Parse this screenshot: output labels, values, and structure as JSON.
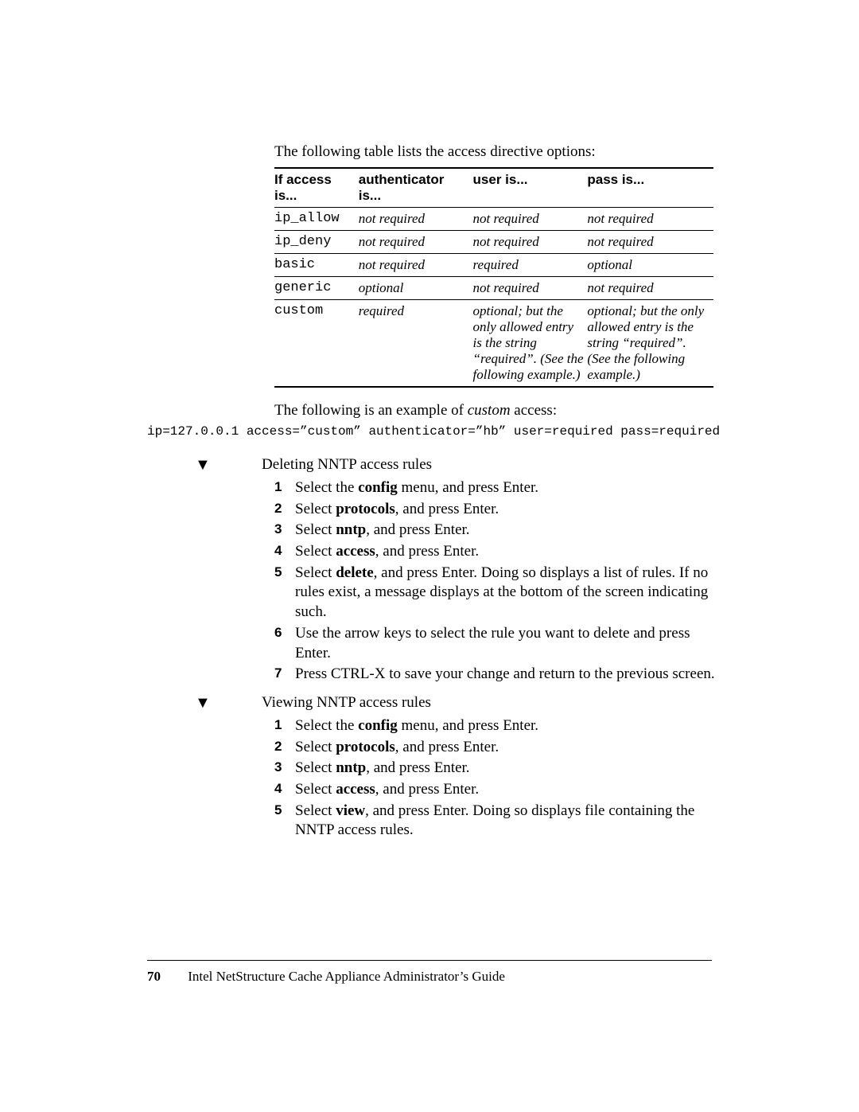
{
  "intro": "The following table lists the access directive options:",
  "table": {
    "headers": [
      "If access is...",
      "authenticator is...",
      "user is...",
      "pass is..."
    ],
    "rows": [
      {
        "access": "ip_allow",
        "auth": "not required",
        "user": "not required",
        "pass": "not required"
      },
      {
        "access": "ip_deny",
        "auth": "not required",
        "user": "not required",
        "pass": "not required"
      },
      {
        "access": "basic",
        "auth": "not required",
        "user": "required",
        "pass": "optional"
      },
      {
        "access": "generic",
        "auth": "optional",
        "user": "not required",
        "pass": "not required"
      },
      {
        "access": "custom",
        "auth": "required",
        "user": "optional; but the only allowed entry is the string “required”. (See the following example.)",
        "pass": "optional; but the only allowed entry is the string “required”. (See the following example.)"
      }
    ]
  },
  "example_intro_pre": "The following is an example of ",
  "example_intro_em": "custom",
  "example_intro_post": " access:",
  "code": "ip=127.0.0.1 access=”custom” authenticator=”hb” user=required pass=required",
  "procedures": [
    {
      "title": "Deleting NNTP access rules",
      "steps": [
        [
          {
            "t": "Select the "
          },
          {
            "b": "config"
          },
          {
            "t": " menu, and press Enter."
          }
        ],
        [
          {
            "t": "Select "
          },
          {
            "b": "protocols"
          },
          {
            "t": ", and press Enter."
          }
        ],
        [
          {
            "t": "Select "
          },
          {
            "b": "nntp"
          },
          {
            "t": ", and press Enter."
          }
        ],
        [
          {
            "t": "Select "
          },
          {
            "b": "access"
          },
          {
            "t": ", and press Enter."
          }
        ],
        [
          {
            "t": "Select "
          },
          {
            "b": "delete"
          },
          {
            "t": ", and press Enter. Doing so displays a list of rules. If no rules exist, a message displays at the bottom of the screen indicating such."
          }
        ],
        [
          {
            "t": "Use the arrow keys to select the rule you want to delete and press Enter."
          }
        ],
        [
          {
            "t": "Press CTRL-X to save your change and return to the previous screen."
          }
        ]
      ]
    },
    {
      "title": "Viewing NNTP access rules",
      "steps": [
        [
          {
            "t": "Select the "
          },
          {
            "b": "config"
          },
          {
            "t": " menu, and press Enter."
          }
        ],
        [
          {
            "t": "Select "
          },
          {
            "b": "protocols"
          },
          {
            "t": ", and press Enter."
          }
        ],
        [
          {
            "t": "Select "
          },
          {
            "b": "nntp"
          },
          {
            "t": ", and press Enter."
          }
        ],
        [
          {
            "t": "Select "
          },
          {
            "b": "access"
          },
          {
            "t": ", and press Enter."
          }
        ],
        [
          {
            "t": "Select "
          },
          {
            "b": "view"
          },
          {
            "t": ", and press Enter. Doing so displays file containing the NNTP access rules."
          }
        ]
      ]
    }
  ],
  "footer": {
    "page": "70",
    "title": "Intel NetStructure Cache Appliance Administrator’s Guide"
  }
}
